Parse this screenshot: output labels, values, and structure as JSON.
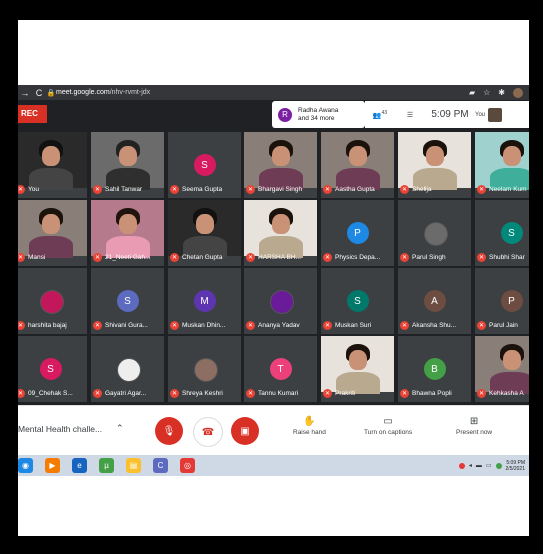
{
  "browser": {
    "back_icon": "arrow-right-icon",
    "url_host": "meet.google.com",
    "url_path": "/nhv-rvmt-jdx"
  },
  "meet": {
    "rec_label": "REC",
    "participants_avatar_letter": "R",
    "participants_line1": "Radha Awana",
    "participants_line2": "and 34 more",
    "participant_count": "43",
    "time": "5:09 PM",
    "you_label": "You",
    "colors": {
      "rec": "#d93025",
      "mic_off": "#ea4335",
      "tile_bg": "#3c4043",
      "screen_bg": "#202124"
    }
  },
  "tiles": [
    {
      "name": "You",
      "avatar": "",
      "color": "#3c4043",
      "photo": "dark"
    },
    {
      "name": "Sahil Tanwar",
      "avatar": "",
      "color": "#3c4043",
      "photo": "man"
    },
    {
      "name": "Seema Gupta",
      "avatar": "S",
      "color": "#d81b60"
    },
    {
      "name": "Bhargavi Singh",
      "avatar": "",
      "color": "#3c4043",
      "photo": "woman"
    },
    {
      "name": "Aastha Gupta",
      "avatar": "",
      "color": "#3c4043",
      "photo": "woman"
    },
    {
      "name": "Shellja",
      "avatar": "",
      "color": "#3c4043",
      "photo": "woman-light"
    },
    {
      "name": "Neelam Kum",
      "avatar": "",
      "color": "#3c4043",
      "photo": "woman-teal"
    },
    {
      "name": "Mansi",
      "avatar": "",
      "color": "#3c4043",
      "photo": "woman"
    },
    {
      "name": "21_Neeti Gah...",
      "avatar": "",
      "color": "#3c4043",
      "photo": "woman-pink"
    },
    {
      "name": "Chetan Gupta",
      "avatar": "",
      "color": "#3c4043",
      "photo": "dark"
    },
    {
      "name": "HARSHA BH...",
      "avatar": "",
      "color": "#3c4043",
      "photo": "woman-light"
    },
    {
      "name": "Physics Depa...",
      "avatar": "P",
      "color": "#1e88e5"
    },
    {
      "name": "Parul Singh",
      "avatar": "",
      "color": "#3c4043",
      "photo": "img-avatar"
    },
    {
      "name": "Shubhi Shar",
      "avatar": "S",
      "color": "#00897b"
    },
    {
      "name": "harshita bajaj",
      "avatar": "",
      "color": "#3c4043",
      "photo": "img-avatar-pink"
    },
    {
      "name": "Shivani Gura...",
      "avatar": "S",
      "color": "#5c6bc0"
    },
    {
      "name": "Muskan Dhin...",
      "avatar": "M",
      "color": "#5e35b1"
    },
    {
      "name": "Ananya Yadav",
      "avatar": "",
      "color": "#3c4043",
      "photo": "img-avatar-purple"
    },
    {
      "name": "Muskan Suri",
      "avatar": "S",
      "color": "#00796b"
    },
    {
      "name": "Akansha Shu...",
      "avatar": "A",
      "color": "#6d4c41"
    },
    {
      "name": "Parul Jain",
      "avatar": "P",
      "color": "#6d4c41"
    },
    {
      "name": "09_Chehak S...",
      "avatar": "S",
      "color": "#d81b60"
    },
    {
      "name": "Gayatri Agar...",
      "avatar": "",
      "color": "#3c4043",
      "photo": "img-avatar-white"
    },
    {
      "name": "Shreya Keshri",
      "avatar": "",
      "color": "#3c4043",
      "photo": "img-avatar-brown"
    },
    {
      "name": "Tannu Kumari",
      "avatar": "T",
      "color": "#ec407a"
    },
    {
      "name": "Prakriti",
      "avatar": "",
      "color": "#3c4043",
      "photo": "woman-light"
    },
    {
      "name": "Bhawna Popli",
      "avatar": "B",
      "color": "#43a047"
    },
    {
      "name": "Kehkasha A",
      "avatar": "",
      "color": "#3c4043",
      "photo": "woman"
    }
  ],
  "bottom": {
    "meeting_title": "Mental Health challe...",
    "raise_hand": "Raise hand",
    "captions": "Turn on captions",
    "present": "Present now"
  },
  "taskbar": {
    "clock_time": "5:09 PM",
    "clock_date": "2/5/2021"
  }
}
